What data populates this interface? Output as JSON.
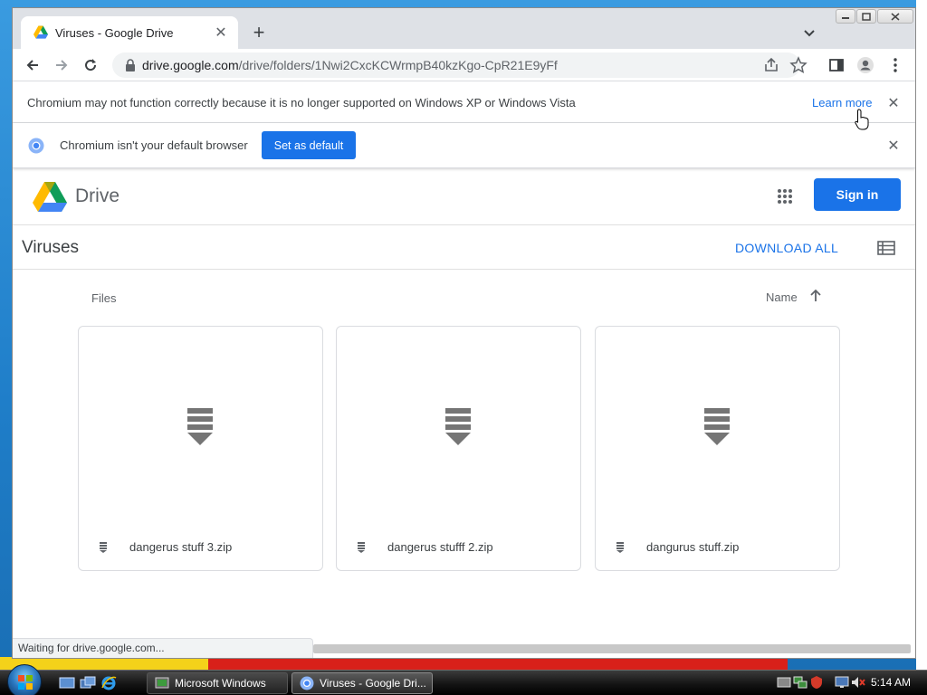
{
  "browser": {
    "tab_title": "Viruses - Google Drive",
    "url_host": "drive.google.com",
    "url_path": "/drive/folders/1Nwi2CxcKCWrmpB40kzKgo-CpR21E9yFf"
  },
  "infobar_unsupported": {
    "message": "Chromium may not function correctly because it is no longer supported on Windows XP or Windows Vista",
    "link": "Learn more"
  },
  "infobar_default": {
    "message": "Chromium isn't your default browser",
    "button": "Set as default"
  },
  "drive": {
    "app_name": "Drive",
    "sign_in": "Sign in",
    "folder_title": "Viruses",
    "download_all": "DOWNLOAD ALL",
    "files_label": "Files",
    "sort_label": "Name",
    "files": [
      {
        "name": "dangerus stuff 3.zip",
        "icon": "zip-icon"
      },
      {
        "name": "dangerus stufff 2.zip",
        "icon": "zip-icon"
      },
      {
        "name": "dangurus stuff.zip",
        "icon": "zip-icon"
      }
    ]
  },
  "status": {
    "text": "Waiting for drive.google.com..."
  },
  "taskbar": {
    "tasks": [
      {
        "label": "Microsoft Windows",
        "icon": "vm-icon"
      },
      {
        "label": "Viruses - Google Dri...",
        "icon": "chromium-icon",
        "active": true
      }
    ],
    "clock": "5:14 AM"
  },
  "colors": {
    "accent": "#1a73e8",
    "tabstrip": "#dee1e6",
    "taskbar": "#141414"
  }
}
